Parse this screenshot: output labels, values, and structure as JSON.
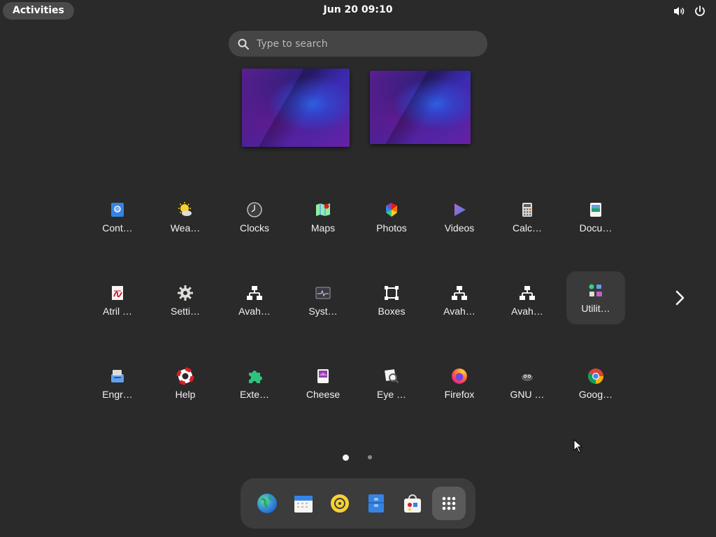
{
  "topbar": {
    "activities_label": "Activities",
    "clock": "Jun 20  09:10",
    "icons": [
      "volume-icon",
      "power-icon"
    ]
  },
  "search": {
    "placeholder": "Type to search",
    "value": ""
  },
  "workspaces": [
    "workspace-1",
    "workspace-2"
  ],
  "apps": [
    {
      "label": "Cont…",
      "icon": "contacts-icon"
    },
    {
      "label": "Wea…",
      "icon": "weather-icon"
    },
    {
      "label": "Clocks",
      "icon": "clocks-icon"
    },
    {
      "label": "Maps",
      "icon": "maps-icon"
    },
    {
      "label": "Photos",
      "icon": "photos-icon"
    },
    {
      "label": "Videos",
      "icon": "videos-icon"
    },
    {
      "label": "Calc…",
      "icon": "calculator-icon"
    },
    {
      "label": "Docu…",
      "icon": "document-viewer-icon"
    },
    {
      "label": "Atril …",
      "icon": "atril-icon"
    },
    {
      "label": "Setti…",
      "icon": "settings-icon"
    },
    {
      "label": "Avah…",
      "icon": "network-icon"
    },
    {
      "label": "Syst…",
      "icon": "system-monitor-icon"
    },
    {
      "label": "Boxes",
      "icon": "boxes-icon"
    },
    {
      "label": "Avah…",
      "icon": "network-icon"
    },
    {
      "label": "Avah…",
      "icon": "network-icon"
    },
    {
      "label": "Utilit…",
      "icon": "utilities-folder-icon"
    },
    {
      "label": "Engr…",
      "icon": "engrampa-icon"
    },
    {
      "label": "Help",
      "icon": "help-icon"
    },
    {
      "label": "Exte…",
      "icon": "extensions-icon"
    },
    {
      "label": "Cheese",
      "icon": "cheese-icon"
    },
    {
      "label": "Eye …",
      "icon": "eye-of-gnome-icon"
    },
    {
      "label": "Firefox",
      "icon": "firefox-icon"
    },
    {
      "label": "GNU …",
      "icon": "gimp-icon"
    },
    {
      "label": "Goog…",
      "icon": "chrome-icon"
    }
  ],
  "pagination": {
    "pages": 2,
    "current": 1
  },
  "dock": [
    "web-browser-icon",
    "calendar-icon",
    "rhythmbox-icon",
    "files-icon",
    "software-icon",
    "app-grid-icon"
  ]
}
